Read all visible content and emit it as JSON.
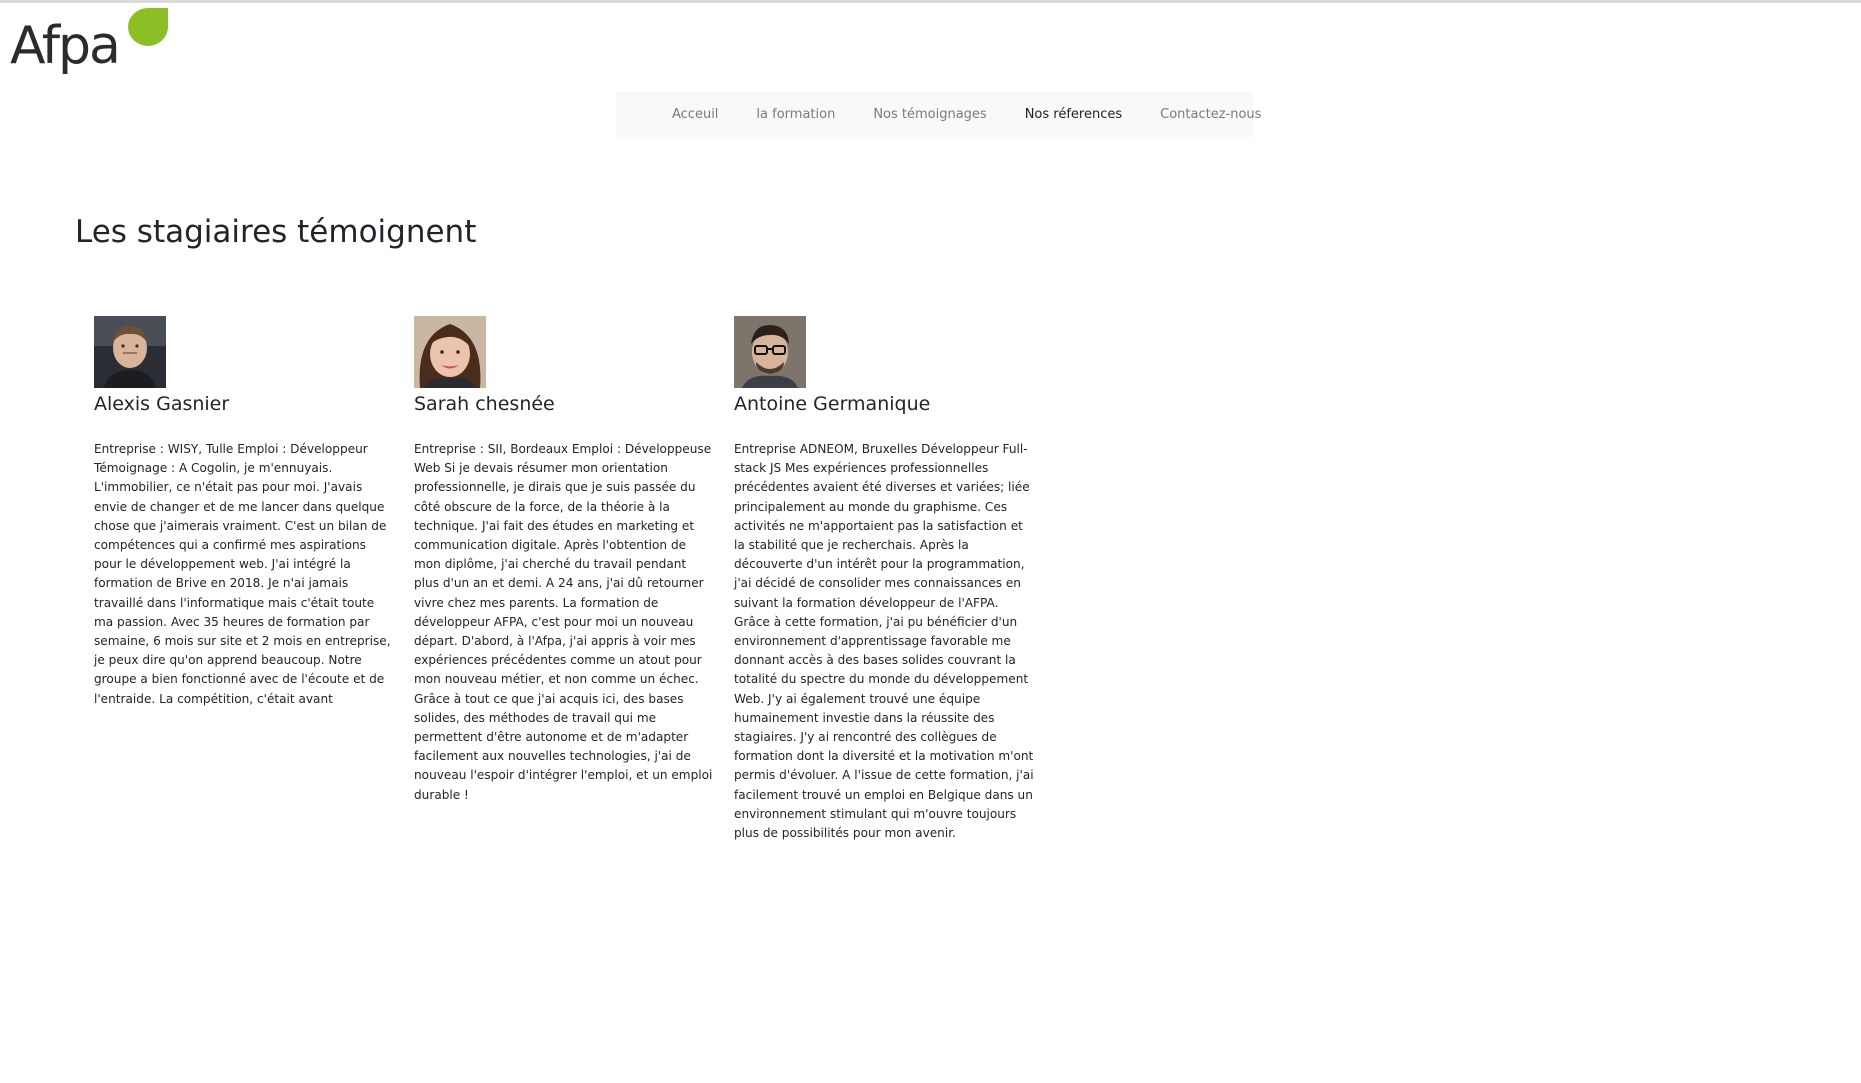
{
  "logo": {
    "text": "Afpa",
    "accent_color": "#8cbf26"
  },
  "nav": {
    "items": [
      {
        "label": "Acceuil",
        "active": false
      },
      {
        "label": "la formation",
        "active": false
      },
      {
        "label": "Nos témoignages",
        "active": false
      },
      {
        "label": "Nos réferences",
        "active": true
      },
      {
        "label": "Contactez-nous",
        "active": false
      }
    ]
  },
  "page": {
    "title": "Les stagiaires témoignent"
  },
  "testimonials": [
    {
      "name": "Alexis Gasnier",
      "avatar": "avatar-man-photo",
      "text": "Entreprise : WISY, Tulle Emploi : Développeur Témoignage : A Cogolin, je m'ennuyais. L'immobilier, ce n'était pas pour moi. J'avais envie de changer et de me lancer dans quelque chose que j'aimerais vraiment. C'est un bilan de compétences qui a confirmé mes aspirations pour le développement web. J'ai intégré la formation de Brive en 2018. Je n'ai jamais travaillé dans l'informatique mais c'était toute ma passion. Avec 35 heures de formation par semaine, 6 mois sur site et 2 mois en entreprise, je peux dire qu'on apprend beaucoup. Notre groupe a bien fonctionné avec de l'écoute et de l'entraide. La compétition, c'était avant"
    },
    {
      "name": "Sarah chesnée",
      "avatar": "avatar-woman-photo",
      "text": "Entreprise : SII, Bordeaux Emploi : Développeuse Web Si je devais résumer mon orientation professionnelle, je dirais que je suis passée du côté obscure de la force, de la théorie à la technique. J'ai fait des études en marketing et communication digitale. Après l'obtention de mon diplôme, j'ai cherché du travail pendant plus d'un an et demi. A 24 ans, j'ai dû retourner vivre chez mes parents. La formation de développeur AFPA, c'est pour moi un nouveau départ. D'abord, à l'Afpa, j'ai appris à voir mes expériences précédentes comme un atout pour mon nouveau métier, et non comme un échec. Grâce à tout ce que j'ai acquis ici, des bases solides, des méthodes de travail qui me permettent d'être autonome et de m'adapter facilement aux nouvelles technologies, j'ai de nouveau l'espoir d'intégrer l'emploi, et un emploi durable !"
    },
    {
      "name": "Antoine Germanique",
      "avatar": "avatar-man-glasses-photo",
      "text": "Entreprise ADNEOM, Bruxelles Développeur Full-stack JS Mes expériences professionnelles précédentes avaient été diverses et variées; liée principalement au monde du graphisme. Ces activités ne m'apportaient pas la satisfaction et la stabilité que je recherchais. Après la découverte d'un intérêt pour la programmation, j'ai décidé de consolider mes connaissances en suivant la formation développeur de l'AFPA. Grâce à cette formation, j'ai pu bénéficier d'un environnement d'apprentissage favorable me donnant accès à des bases solides couvrant la totalité du spectre du monde du développement Web. J'y ai également trouvé une équipe humainement investie dans la réussite des stagiaires. J'y ai rencontré des collègues de formation dont la diversité et la motivation m'ont permis d'évoluer. A l'issue de cette formation, j'ai facilement trouvé un emploi en Belgique dans un environnement stimulant qui m'ouvre toujours plus de possibilités pour mon avenir."
    }
  ]
}
